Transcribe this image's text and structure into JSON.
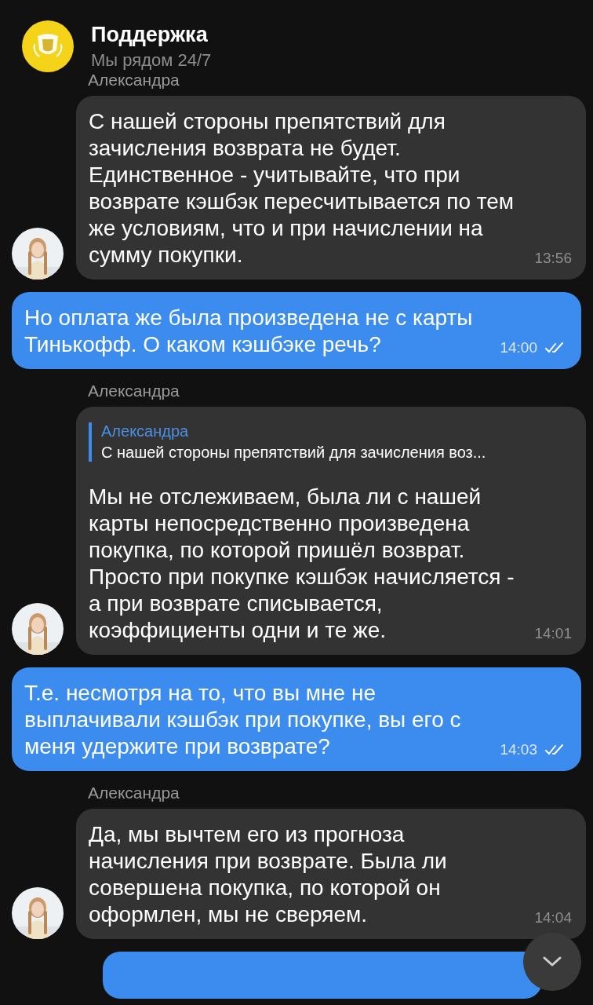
{
  "header": {
    "title": "Поддержка",
    "subtitle": "Мы рядом 24/7"
  },
  "messages": [
    {
      "kind": "incoming",
      "sender": "Александра",
      "text": "С нашей стороны препятствий для зачисления возврата не будет. Единственное - учитывайте, что при возврате кэшбэк пересчитывается по тем же условиям, что и при начислении на сумму покупки.",
      "time": "13:56"
    },
    {
      "kind": "outgoing",
      "text": "Но оплата же была произведена не с карты Тинькофф. О каком кэшбэке речь?",
      "time": "14:00",
      "read": true
    },
    {
      "kind": "incoming",
      "sender": "Александра",
      "reply": {
        "author": "Александра",
        "text": "С нашей стороны препятствий для зачисления воз..."
      },
      "text": "Мы не отслеживаем, была ли с нашей карты непосредственно произведена покупка, по которой пришёл возврат. Просто при покупке кэшбэк начисляется - а при возврате списывается, коэффициенты одни и те же.",
      "time": "14:01"
    },
    {
      "kind": "outgoing",
      "text": "Т.е. несмотря на то, что вы мне не выплачивали кэшбэк при покупке, вы его с меня удержите при возврате?",
      "time": "14:03",
      "read": true
    },
    {
      "kind": "incoming",
      "sender": "Александра",
      "text": "Да, мы вычтем его из прогноза начисления при возврате. Была ли совершена покупка, по которой он оформлен, мы не сверяем.",
      "time": "14:04"
    },
    {
      "kind": "outgoing_partial"
    }
  ]
}
